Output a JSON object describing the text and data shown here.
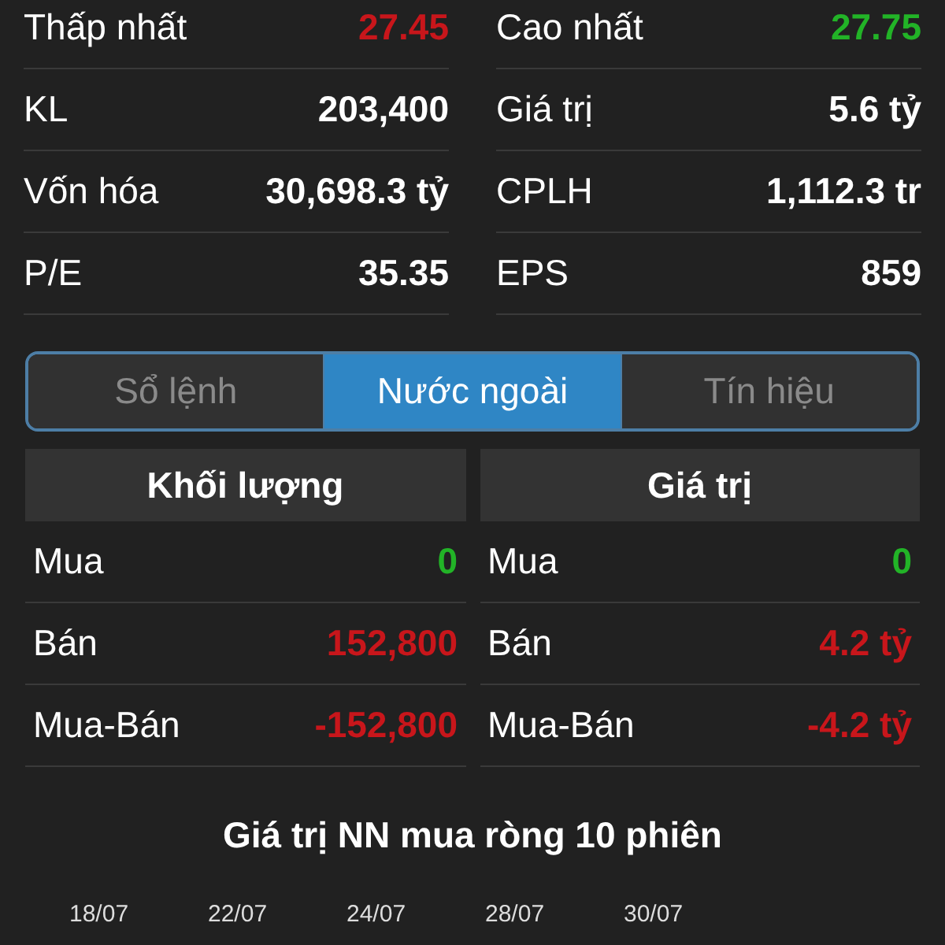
{
  "stats": [
    {
      "label": "Thấp nhất",
      "value": "27.45",
      "color": "#c8161b"
    },
    {
      "label": "Cao nhất",
      "value": "27.75",
      "color": "#22b327"
    },
    {
      "label": "KL",
      "value": "203,400",
      "color": "#ffffff"
    },
    {
      "label": "Giá trị",
      "value": "5.6 tỷ",
      "color": "#ffffff"
    },
    {
      "label": "Vốn hóa",
      "value": "30,698.3 tỷ",
      "color": "#ffffff"
    },
    {
      "label": "CPLH",
      "value": "1,112.3 tr",
      "color": "#ffffff"
    },
    {
      "label": "P/E",
      "value": "35.35",
      "color": "#ffffff"
    },
    {
      "label": "EPS",
      "value": "859",
      "color": "#ffffff"
    }
  ],
  "tabs": [
    {
      "label": "Sổ lệnh",
      "selected": false
    },
    {
      "label": "Nước ngoài",
      "selected": true
    },
    {
      "label": "Tín hiệu",
      "selected": false
    }
  ],
  "tables": [
    {
      "title": "Khối lượng",
      "rows": [
        {
          "label": "Mua",
          "value": "0",
          "color": "#22b327"
        },
        {
          "label": "Bán",
          "value": "152,800",
          "color": "#c8161b"
        },
        {
          "label": "Mua-Bán",
          "value": "-152,800",
          "color": "#c8161b"
        }
      ]
    },
    {
      "title": "Giá trị",
      "rows": [
        {
          "label": "Mua",
          "value": "0",
          "color": "#22b327"
        },
        {
          "label": "Bán",
          "value": "4.2 tỷ",
          "color": "#c8161b"
        },
        {
          "label": "Mua-Bán",
          "value": "-4.2 tỷ",
          "color": "#c8161b"
        }
      ]
    }
  ],
  "chart": {
    "title": "Giá trị NN mua ròng 10 phiên",
    "dates": [
      "18/07",
      "22/07",
      "24/07",
      "28/07",
      "30/07"
    ]
  }
}
